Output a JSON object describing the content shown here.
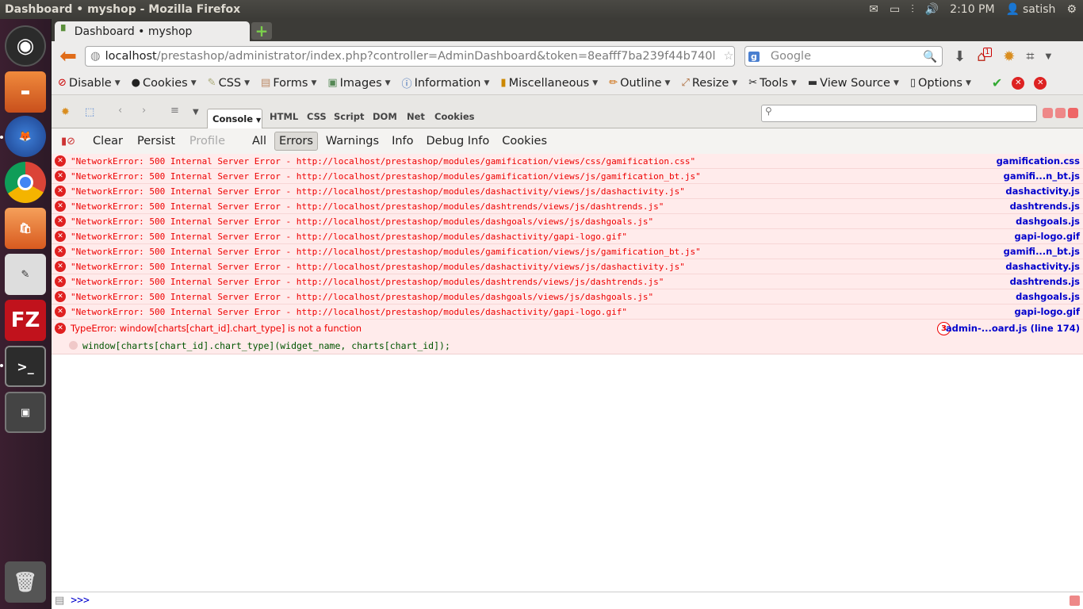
{
  "topbar": {
    "title": "Dashboard • myshop - Mozilla Firefox",
    "time": "2:10 PM",
    "user": "satish"
  },
  "tab": {
    "title": "Dashboard • myshop"
  },
  "urlbar": {
    "host": "localhost",
    "path": "/prestashop/administrator/index.php?controller=AdminDashboard&token=8eafff7ba239f44b740l"
  },
  "search": {
    "placeholder": "Google"
  },
  "home_badge": "1",
  "webdev": {
    "items": [
      "Disable",
      "Cookies",
      "CSS",
      "Forms",
      "Images",
      "Information",
      "Miscellaneous",
      "Outline",
      "Resize",
      "Tools",
      "View Source",
      "Options"
    ]
  },
  "firebug": {
    "tabs": [
      "Console",
      "HTML",
      "CSS",
      "Script",
      "DOM",
      "Net",
      "Cookies"
    ]
  },
  "filters": {
    "clear": "Clear",
    "persist": "Persist",
    "profile": "Profile",
    "all": "All",
    "errors": "Errors",
    "warnings": "Warnings",
    "info": "Info",
    "debug": "Debug Info",
    "cookies": "Cookies"
  },
  "errors": [
    {
      "msg": "\"NetworkError: 500 Internal Server Error - http://localhost/prestashop/modules/gamification/views/css/gamification.css\"",
      "src": "gamification.css"
    },
    {
      "msg": "\"NetworkError: 500 Internal Server Error - http://localhost/prestashop/modules/gamification/views/js/gamification_bt.js\"",
      "src": "gamifi...n_bt.js"
    },
    {
      "msg": "\"NetworkError: 500 Internal Server Error - http://localhost/prestashop/modules/dashactivity/views/js/dashactivity.js\"",
      "src": "dashactivity.js"
    },
    {
      "msg": "\"NetworkError: 500 Internal Server Error - http://localhost/prestashop/modules/dashtrends/views/js/dashtrends.js\"",
      "src": "dashtrends.js"
    },
    {
      "msg": "\"NetworkError: 500 Internal Server Error - http://localhost/prestashop/modules/dashgoals/views/js/dashgoals.js\"",
      "src": "dashgoals.js"
    },
    {
      "msg": "\"NetworkError: 500 Internal Server Error - http://localhost/prestashop/modules/dashactivity/gapi-logo.gif\"",
      "src": "gapi-logo.gif"
    },
    {
      "msg": "\"NetworkError: 500 Internal Server Error - http://localhost/prestashop/modules/gamification/views/js/gamification_bt.js\"",
      "src": "gamifi...n_bt.js"
    },
    {
      "msg": "\"NetworkError: 500 Internal Server Error - http://localhost/prestashop/modules/dashactivity/views/js/dashactivity.js\"",
      "src": "dashactivity.js"
    },
    {
      "msg": "\"NetworkError: 500 Internal Server Error - http://localhost/prestashop/modules/dashtrends/views/js/dashtrends.js\"",
      "src": "dashtrends.js"
    },
    {
      "msg": "\"NetworkError: 500 Internal Server Error - http://localhost/prestashop/modules/dashgoals/views/js/dashgoals.js\"",
      "src": "dashgoals.js"
    },
    {
      "msg": "\"NetworkError: 500 Internal Server Error - http://localhost/prestashop/modules/dashactivity/gapi-logo.gif\"",
      "src": "gapi-logo.gif"
    }
  ],
  "typeerror": {
    "msg": "TypeError: window[charts[chart_id].chart_type] is not a function",
    "count": "3",
    "src": "admin-...oard.js (line 174)",
    "stack": "window[charts[chart_id].chart_type](widget_name, charts[chart_id]);"
  },
  "cmdline": {
    "prompt": ">>>"
  }
}
